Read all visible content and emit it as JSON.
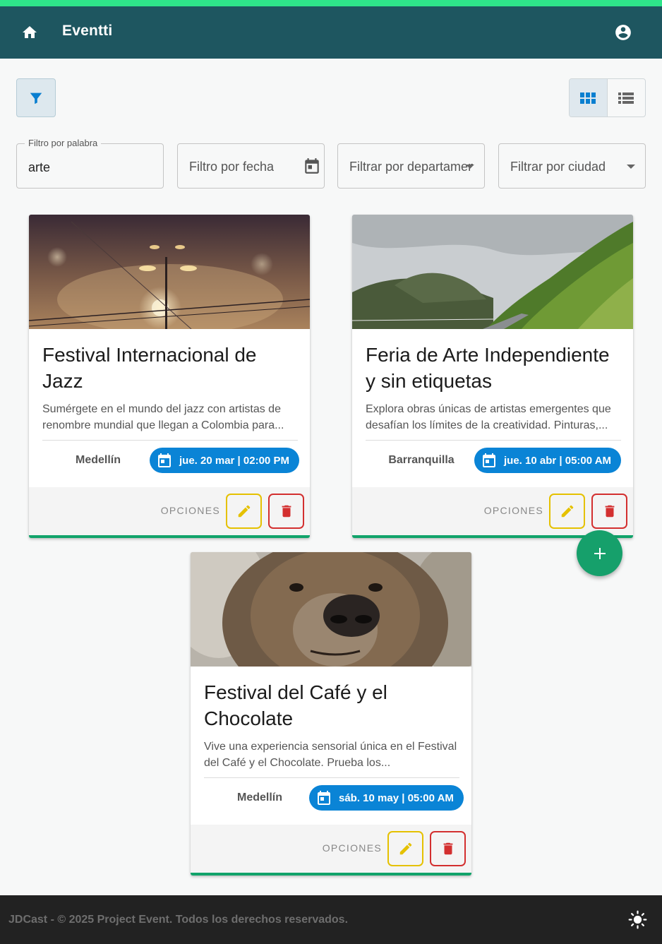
{
  "app": {
    "title": "Eventti",
    "icons": {
      "home": "home-icon",
      "account": "account-circle-icon"
    }
  },
  "toolbar": {
    "filter_icon": "filter-icon",
    "view_grid_icon": "grid-view-icon",
    "view_list_icon": "list-view-icon",
    "active_view": "grid"
  },
  "filters": {
    "keyword": {
      "label": "Filtro por palabra",
      "value": "arte"
    },
    "date": {
      "placeholder": "Filtro por fecha",
      "icon": "calendar-icon"
    },
    "department": {
      "placeholder": "Filtrar por departamento"
    },
    "city": {
      "placeholder": "Filtrar por ciudad"
    }
  },
  "cards": [
    {
      "title": "Festival Internacional de Jazz",
      "description": "Sumérgete en el mundo del jazz con artistas de renombre mundial que llegan a Colombia para...",
      "city": "Medellín",
      "date": "jue. 20 mar | 02:00 PM",
      "options_label": "OPCIONES",
      "image": "foggy-lamps-image"
    },
    {
      "title": "Feria de Arte Independiente y sin etiquetas",
      "description": "Explora obras únicas de artistas emergentes que desafían los límites de la creatividad. Pinturas,...",
      "city": "Barranquilla",
      "date": "jue. 10 abr | 05:00 AM",
      "options_label": "OPCIONES",
      "image": "mountain-valley-image"
    },
    {
      "title": "Festival del Café y el Chocolate",
      "description": "Vive una experiencia sensorial única en el Festival del Café y el Chocolate. Prueba los...",
      "city": "Medellín",
      "date": "sáb. 10 may | 05:00 AM",
      "options_label": "OPCIONES",
      "image": "bear-image"
    }
  ],
  "fab": {
    "icon": "plus-icon"
  },
  "footer": {
    "text": "JDCast - © 2025 Project Event. Todos los derechos reservados.",
    "theme_icon": "sun-icon"
  },
  "colors": {
    "appbar": "#1e5660",
    "accent_line": "#2ee58a",
    "chip": "#0a84d6",
    "edit": "#e5c100",
    "delete": "#d32f2f",
    "fab": "#16a06b",
    "card_bar": "#11a36a"
  }
}
